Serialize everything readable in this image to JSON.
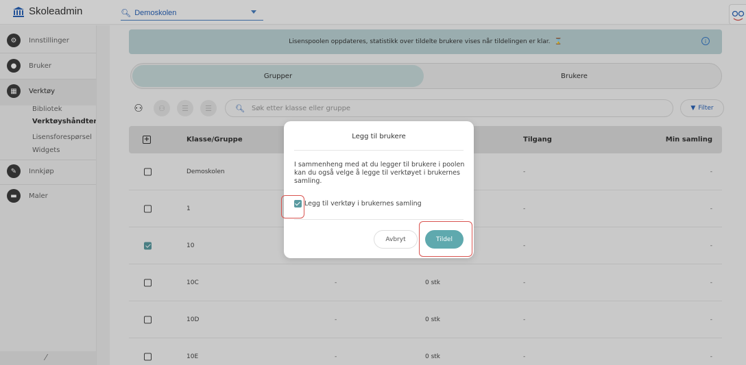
{
  "app": {
    "title": "Skoleadmin"
  },
  "school_select": {
    "value": "Demoskolen"
  },
  "sidebar": {
    "items": [
      {
        "label": "Innstillinger",
        "icon": "gear-icon"
      },
      {
        "label": "Bruker",
        "icon": "user-icon"
      },
      {
        "label": "Verktøy",
        "icon": "tools-grid-icon"
      },
      {
        "label": "Innkjøp",
        "icon": "purchase-icon"
      },
      {
        "label": "Maler",
        "icon": "folder-icon"
      }
    ],
    "sub_items": [
      "Bibliotek",
      "Verktøyshåndtering",
      "Lisensforespørsel",
      "Widgets"
    ],
    "active_sub": "Verktøyshåndtering"
  },
  "banner": {
    "text": "Lisenspoolen oppdateres, statistikk over tildelte brukere vises når tildelingen er klar."
  },
  "segment": {
    "tab_groups": "Grupper",
    "tab_users": "Brukere",
    "active": "Grupper"
  },
  "search": {
    "placeholder": "Søk etter klasse eller gruppe"
  },
  "filter": {
    "label": "Filter"
  },
  "table": {
    "headers": {
      "group": "Klasse/Gruppe",
      "access": "Tilgang",
      "collection": "Min samling"
    },
    "rows": [
      {
        "name": "Demoskolen",
        "col2": "",
        "count": "",
        "access": "-",
        "collection": "-",
        "checked": false
      },
      {
        "name": "1",
        "col2": "",
        "count": "",
        "access": "-",
        "collection": "-",
        "checked": false
      },
      {
        "name": "10",
        "col2": "",
        "count": "",
        "access": "-",
        "collection": "-",
        "checked": true
      },
      {
        "name": "10C",
        "col2": "-",
        "count": "0 stk",
        "access": "-",
        "collection": "-",
        "checked": false
      },
      {
        "name": "10D",
        "col2": "-",
        "count": "0 stk",
        "access": "-",
        "collection": "-",
        "checked": false
      },
      {
        "name": "10E",
        "col2": "-",
        "count": "0 stk",
        "access": "-",
        "collection": "-",
        "checked": false
      }
    ]
  },
  "modal": {
    "title": "Legg til brukere",
    "body": "I sammenheng med at du legger til brukere i poolen kan du også velge å legge til verktøyet i brukernes samling.",
    "checkbox_label": "Legg til verktøy i brukernes samling",
    "checkbox_checked": true,
    "cancel_label": "Avbryt",
    "confirm_label": "Tildel"
  },
  "colors": {
    "accent": "#5fa9ae",
    "link": "#2a63b8",
    "highlight": "#d9534f"
  }
}
